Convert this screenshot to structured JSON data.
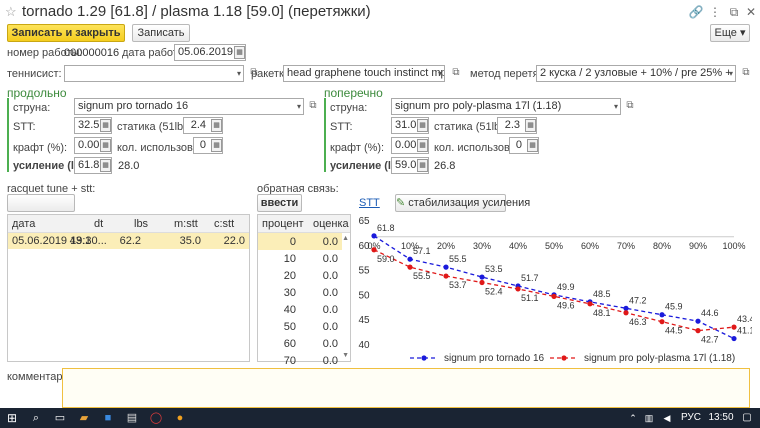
{
  "window": {
    "title": "tornado 1.29 [61.8] / plasma 1.18 [59.0] (перетяжки)"
  },
  "toolbar": {
    "save_close": "Записать и закрыть",
    "save": "Записать",
    "more": "Еще"
  },
  "header": {
    "job_number_label": "номер работы:",
    "job_number": "000000016",
    "job_date_label": "дата работы:",
    "job_date": "05.06.2019",
    "player_label": "теннисист:",
    "player": "",
    "racket_label": "ракетка:",
    "racket": "head graphene touch instinct mp",
    "method_label": "метод перетяжки:",
    "method": "2 куска / 2 узловые + 10% / pre 25% + скорость 3"
  },
  "mains": {
    "title": "продольно",
    "string_label": "струна:",
    "string": "signum pro tornado 16",
    "stt_label": "STT:",
    "stt": "32.5",
    "static_label": "статика (51lbs):",
    "static": "2.4",
    "kraft_label": "крафт (%):",
    "kraft": "0.00",
    "uses_label": "кол. использований:",
    "uses": "0",
    "gain_label": "усиление (lbs):",
    "gain": "61.8",
    "gain_extra": "28.0"
  },
  "crosses": {
    "title": "поперечно",
    "string_label": "струна:",
    "string": "signum pro poly-plasma 17l (1.18)",
    "stt_label": "STT:",
    "stt": "31.0",
    "static_label": "статика (51lbs):",
    "static": "2.3",
    "kraft_label": "крафт (%):",
    "kraft": "0.00",
    "uses_label": "кол. использований:",
    "uses": "0",
    "gain_label": "усиление (lbs):",
    "gain": "59.0",
    "gain_extra": "26.8"
  },
  "tune": {
    "label": "racquet tune + stt:"
  },
  "feedback": {
    "label": "обратная связь:",
    "button": "ввести"
  },
  "links": {
    "stt": "STT",
    "stabilize": "стабилизация усиления"
  },
  "history_table": {
    "columns": [
      "дата",
      "dt",
      "lbs",
      "m:stt",
      "c:stt"
    ],
    "rows": [
      [
        "05.06.2019 19:30...",
        "43.1",
        "62.2",
        "35.0",
        "22.0"
      ]
    ]
  },
  "percent_table": {
    "columns": [
      "процент",
      "оценка"
    ],
    "rows": [
      [
        "0",
        "0.0"
      ],
      [
        "10",
        "0.0"
      ],
      [
        "20",
        "0.0"
      ],
      [
        "30",
        "0.0"
      ],
      [
        "40",
        "0.0"
      ],
      [
        "50",
        "0.0"
      ],
      [
        "60",
        "0.0"
      ],
      [
        "70",
        "0.0"
      ]
    ]
  },
  "comment": {
    "label": "комментарий:"
  },
  "chart_data": {
    "type": "line",
    "x": [
      "0%",
      "10%",
      "20%",
      "30%",
      "40%",
      "50%",
      "60%",
      "70%",
      "80%",
      "90%",
      "100%"
    ],
    "ylim": [
      40,
      65
    ],
    "yticks": [
      40,
      45,
      50,
      55,
      60,
      65
    ],
    "series": [
      {
        "name": "signum pro tornado 16",
        "color": "#1a1adb",
        "values": [
          61.8,
          57.1,
          55.5,
          53.5,
          51.7,
          49.9,
          48.5,
          47.2,
          45.9,
          44.6,
          41.1
        ]
      },
      {
        "name": "signum pro poly-plasma 17l (1.18)",
        "color": "#e01818",
        "values": [
          59.0,
          55.5,
          53.7,
          52.4,
          51.1,
          49.6,
          48.1,
          46.3,
          44.5,
          42.7,
          43.4
        ]
      }
    ]
  },
  "taskbar": {
    "lang": "РУС",
    "time": "13:50"
  }
}
